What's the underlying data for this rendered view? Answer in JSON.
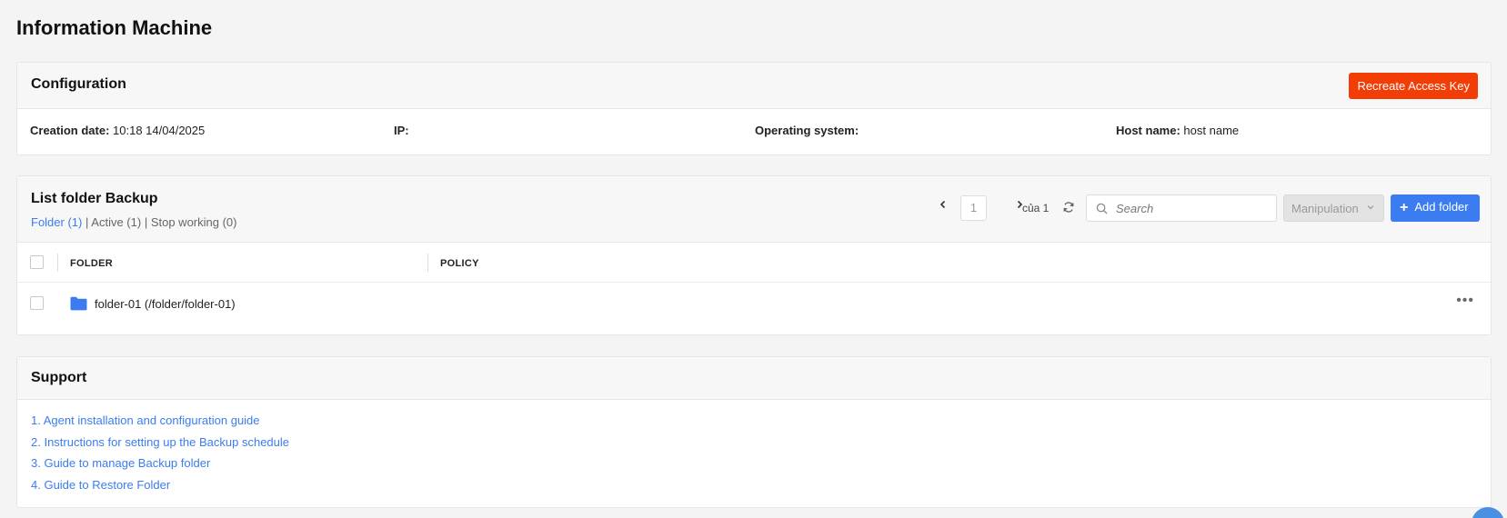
{
  "page": {
    "title": "Information Machine"
  },
  "config": {
    "title": "Configuration",
    "recreate_label": "Recreate Access Key",
    "creation_date_label": "Creation date:",
    "creation_date_value": "10:18 14/04/2025",
    "ip_label": "IP:",
    "ip_value": "",
    "os_label": "Operating system:",
    "os_value": "",
    "host_label": "Host name:",
    "host_value": "host name"
  },
  "backup": {
    "title": "List folder Backup",
    "filters": {
      "folder": "Folder (1)",
      "active": "Active (1)",
      "stop": "Stop working (0)",
      "separator": "|"
    },
    "pager": {
      "page": "1",
      "of_label": "của 1"
    },
    "search_placeholder": "Search",
    "manipulation_label": "Manipulation",
    "add_label": "Add folder",
    "columns": {
      "folder": "FOLDER",
      "policy": "POLICY"
    },
    "rows": [
      {
        "name": "folder-01 (/folder/folder-01)",
        "policy": ""
      }
    ],
    "more_glyph": "•••"
  },
  "support": {
    "title": "Support",
    "links": [
      "1. Agent installation and configuration guide",
      "2. Instructions for setting up the Backup schedule",
      "3. Guide to manage Backup folder",
      "4. Guide to Restore Folder"
    ]
  },
  "colors": {
    "accent": "#3b7cf0",
    "danger": "#f23d06",
    "folder_icon": "#3b7cf0"
  },
  "icons": {
    "prev": "chevron-left-icon",
    "next": "chevron-right-icon",
    "refresh": "refresh-icon",
    "search": "search-icon",
    "dropdown": "chevron-down-icon",
    "add": "plus-icon",
    "folder": "folder-icon",
    "more": "more-horizontal-icon"
  }
}
